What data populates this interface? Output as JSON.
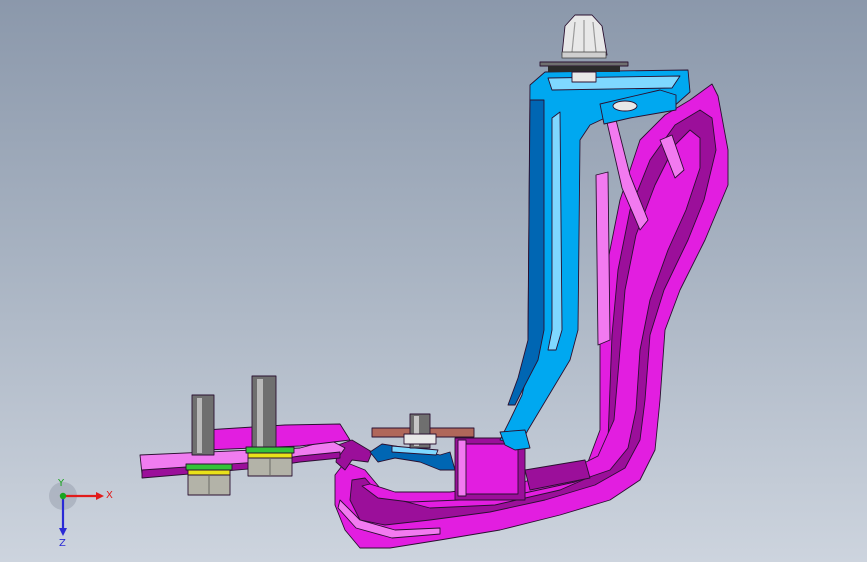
{
  "viewport": {
    "background_top": "#8b98ab",
    "background_bottom": "#cdd4de"
  },
  "model": {
    "colors": {
      "housing": "#e21ee0",
      "housing_dark": "#9b0f9a",
      "housing_light": "#f27af0",
      "bracket": "#00a8f0",
      "bracket_dark": "#0066b3",
      "bracket_light": "#7fd8ff",
      "base_plate": "#f07cf0",
      "steel": "#6f6f6f",
      "nut": "#b3b3a8",
      "washer_yellow": "#e9e21a",
      "washer_green": "#34c23a",
      "clip": "#e8e8e8",
      "strip": "#b0675a"
    }
  },
  "triad": {
    "x_label": "X",
    "y_label": "Y",
    "z_label": "Z",
    "x_color": "#e11b1b",
    "y_color": "#19a51f",
    "z_color": "#2a2ad6"
  }
}
